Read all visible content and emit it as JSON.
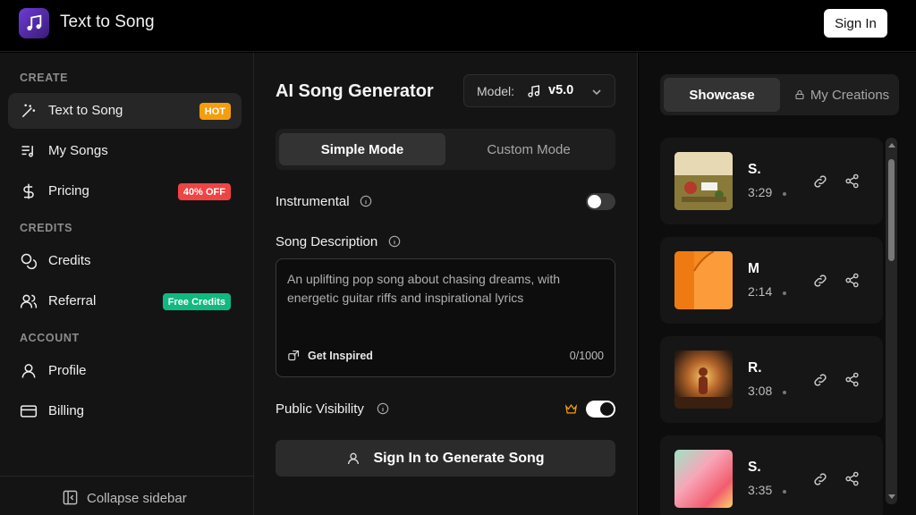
{
  "header": {
    "app_title": "Text to Song",
    "sign_in": "Sign In"
  },
  "sidebar": {
    "sections": {
      "create": "CREATE",
      "credits": "CREDITS",
      "account": "ACCOUNT"
    },
    "items": [
      {
        "label": "Text to Song",
        "icon": "magic-wand-icon",
        "badge": "HOT",
        "active": true
      },
      {
        "label": "My Songs",
        "icon": "music-list-icon"
      },
      {
        "label": "Pricing",
        "icon": "dollar-icon",
        "badge": "40% OFF"
      },
      {
        "label": "Credits",
        "icon": "coins-icon"
      },
      {
        "label": "Referral",
        "icon": "users-icon",
        "badge": "Free Credits"
      },
      {
        "label": "Profile",
        "icon": "user-icon"
      },
      {
        "label": "Billing",
        "icon": "credit-card-icon"
      }
    ],
    "collapse": "Collapse sidebar"
  },
  "main": {
    "title": "AI Song Generator",
    "model": {
      "label": "Model:",
      "version": "v5.0"
    },
    "modes": {
      "simple": "Simple Mode",
      "custom": "Custom Mode"
    },
    "instrumental": {
      "label": "Instrumental",
      "enabled": false
    },
    "description": {
      "label": "Song Description",
      "placeholder": "An uplifting pop song about chasing dreams, with energetic guitar riffs and inspirational lyrics",
      "inspire": "Get Inspired",
      "counter": "0/1000"
    },
    "visibility": {
      "label": "Public Visibility",
      "enabled": true
    },
    "generate": "Sign In to Generate Song"
  },
  "right": {
    "tabs": {
      "showcase": "Showcase",
      "my_creations": "My Creations"
    },
    "songs": [
      {
        "title": "S.",
        "duration": "3:29"
      },
      {
        "title": "M",
        "duration": "2:14"
      },
      {
        "title": "R.",
        "duration": "3:08"
      },
      {
        "title": "S.",
        "duration": "3:35"
      }
    ]
  },
  "colors": {
    "hot": "#f59e0b",
    "off": "#ef4444",
    "free": "#10b981",
    "accent": "#6d3bd6"
  }
}
